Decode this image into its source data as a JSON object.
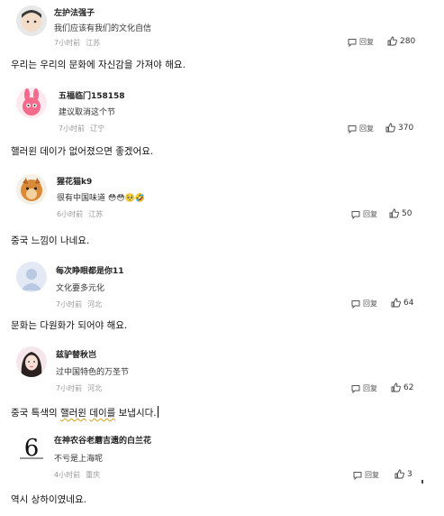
{
  "comments": [
    {
      "user": "左护法强子",
      "text": "我们应该有我们的文化自信",
      "time": "7小时前",
      "location": "江苏",
      "reply": "回复",
      "likes": "280",
      "translation": "우리는 우리의 문화에 자신감을 가져야 해요."
    },
    {
      "user": "五福临门158158",
      "text": "建议取消这个节",
      "time": "7小时前",
      "location": "辽宁",
      "reply": "回复",
      "likes": "370",
      "translation": "핼러윈 데이가 없어졌으면 좋겠어요."
    },
    {
      "user": "猩花猫k9",
      "text": "很有中国味道 😳😳🥺🤣",
      "time": "6小时前",
      "location": "江苏",
      "reply": "回复",
      "likes": "50",
      "translation": "중국 느낌이 나네요."
    },
    {
      "user": "每次睁眼都是你11",
      "text": "文化要多元化",
      "time": "7小时前",
      "location": "河北",
      "reply": "回复",
      "likes": "64",
      "translation": "문화는 다원화가 되어야 해요."
    },
    {
      "user": "兹驴替秋岂",
      "text": "过中国特色的万圣节",
      "time": "7小时前",
      "location": "河北",
      "reply": "回复",
      "likes": "62",
      "translation_pre": "중국 특색의 ",
      "translation_hl1": "핼러윈",
      "translation_mid": " ",
      "translation_hl2": "데이를",
      "translation_post": " 보냅시다."
    },
    {
      "user": "在神农谷老蘑吉遗的白兰花",
      "text": "不亏是上海呢",
      "time": "4小时前",
      "location": "重庆",
      "reply": "回复",
      "likes": "3",
      "translation": "역시 상하이였네요."
    }
  ]
}
